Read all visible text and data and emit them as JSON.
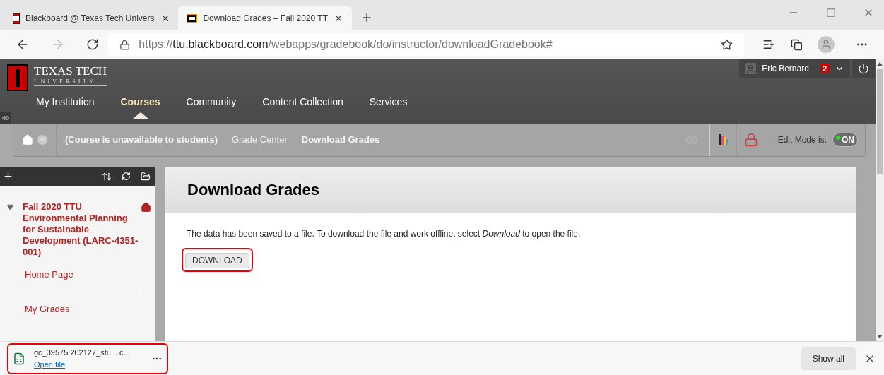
{
  "browser": {
    "tabs": [
      {
        "title": "Blackboard @ Texas Tech Univers",
        "selected": false,
        "kind": "ttu"
      },
      {
        "title": "Download Grades – Fall 2020 TT",
        "selected": true,
        "kind": "bb"
      }
    ],
    "url": {
      "scheme": "https://",
      "host": "ttu.blackboard.com",
      "path": "/webapps/gradebook/do/instructor/downloadGradebook#"
    }
  },
  "header": {
    "logo_title": "TEXAS TECH",
    "logo_subtitle": "UNIVERSITY.",
    "user": "Eric Bernard",
    "notifications": "2",
    "nav": [
      {
        "label": "My Institution",
        "selected": false
      },
      {
        "label": "Courses",
        "selected": true
      },
      {
        "label": "Community",
        "selected": false
      },
      {
        "label": "Content Collection",
        "selected": false
      },
      {
        "label": "Services",
        "selected": false
      }
    ]
  },
  "breadcrumb": {
    "items": [
      {
        "label": "(Course is unavailable to students)",
        "kind": "note"
      },
      {
        "label": "Grade Center",
        "kind": "link"
      },
      {
        "label": "Download Grades",
        "kind": "current"
      }
    ],
    "edit_mode": {
      "label": "Edit Mode is:",
      "value": "ON",
      "on": true
    }
  },
  "sidebar": {
    "course": "Fall 2020 TTU Environmental Planning for Sustainable Development (LARC-4351-001)",
    "expanded": true,
    "items": [
      "Home Page",
      "My Grades"
    ]
  },
  "content": {
    "title": "Download Grades",
    "message": "The data has been saved to a file. To download the file and work offline, select *Download* to open the file.",
    "button": "DOWNLOAD"
  },
  "download_bar": {
    "file": "gc_39575.202127_stu....c...",
    "link": "Open file",
    "show_all": "Show all"
  }
}
